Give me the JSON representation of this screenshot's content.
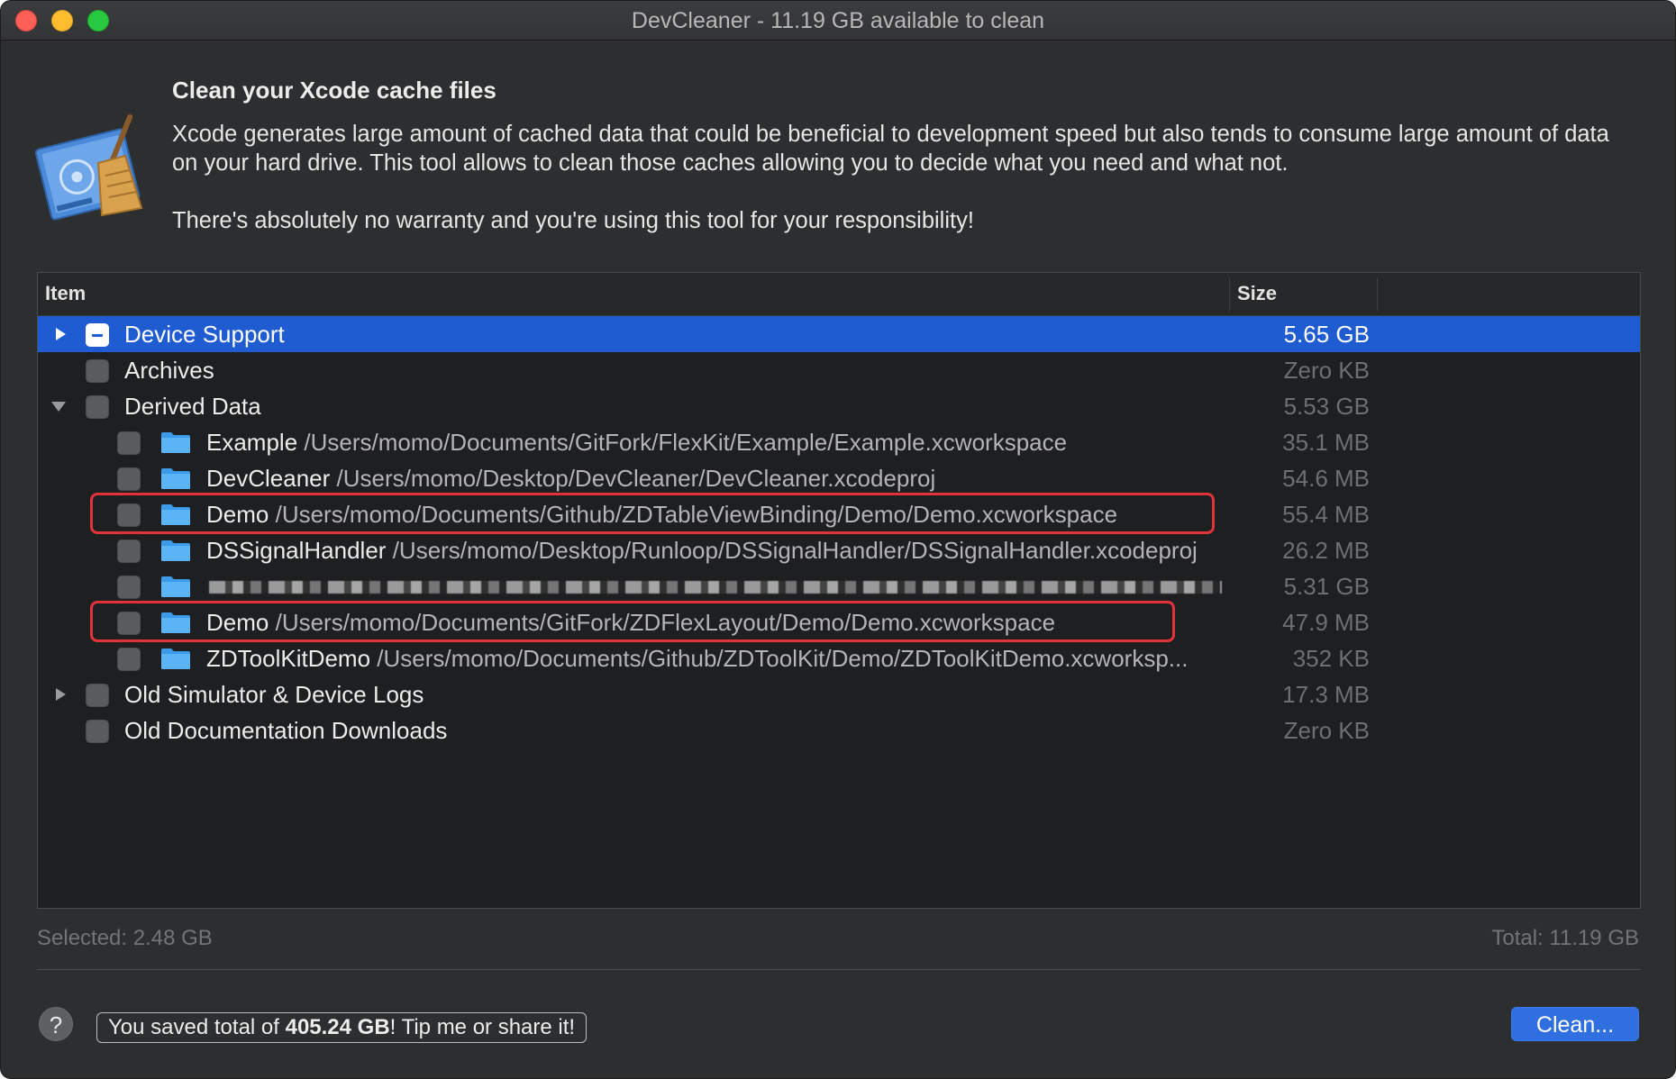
{
  "window": {
    "title": "DevCleaner - 11.19 GB available to clean"
  },
  "header": {
    "heading": "Clean your Xcode cache files",
    "description": "Xcode generates large amount of cached data that could be beneficial to development speed but also tends to consume large amount of data on your hard drive. This tool allows to clean those caches allowing you to decide what you need and what not.",
    "warning": "There's absolutely no warranty and you're using this tool for your responsibility!"
  },
  "table": {
    "columns": {
      "item": "Item",
      "size": "Size"
    },
    "rows": [
      {
        "name": "Device Support",
        "path": "",
        "size": "5.65 GB"
      },
      {
        "name": "Archives",
        "path": "",
        "size": "Zero KB"
      },
      {
        "name": "Derived Data",
        "path": "",
        "size": "5.53 GB"
      },
      {
        "name": "Example",
        "path": "/Users/momo/Documents/GitFork/FlexKit/Example/Example.xcworkspace",
        "size": "35.1 MB"
      },
      {
        "name": "DevCleaner",
        "path": "/Users/momo/Desktop/DevCleaner/DevCleaner.xcodeproj",
        "size": "54.6 MB"
      },
      {
        "name": "Demo",
        "path": "/Users/momo/Documents/Github/ZDTableViewBinding/Demo/Demo.xcworkspace",
        "size": "55.4 MB"
      },
      {
        "name": "DSSignalHandler",
        "path": "/Users/momo/Desktop/Runloop/DSSignalHandler/DSSignalHandler.xcodeproj",
        "size": "26.2 MB"
      },
      {
        "name": "",
        "path": "",
        "size": "5.31 GB"
      },
      {
        "name": "Demo",
        "path": "/Users/momo/Documents/GitFork/ZDFlexLayout/Demo/Demo.xcworkspace",
        "size": "47.9 MB"
      },
      {
        "name": "ZDToolKitDemo",
        "path": "/Users/momo/Documents/Github/ZDToolKit/Demo/ZDToolKitDemo.xcworksp...",
        "size": "352 KB"
      },
      {
        "name": "Old Simulator & Device Logs",
        "path": "",
        "size": "17.3 MB"
      },
      {
        "name": "Old Documentation Downloads",
        "path": "",
        "size": "Zero KB"
      }
    ]
  },
  "footer": {
    "selected": "Selected: 2.48 GB",
    "total": "Total: 11.19 GB",
    "help_label": "?",
    "tip_prefix": "You saved total of ",
    "tip_amount": "405.24 GB",
    "tip_suffix": "! Tip me or share it!",
    "clean_button": "Clean..."
  },
  "colors": {
    "selection": "#1f5bd1",
    "highlight": "#e0343a",
    "primary_button": "#2f6fe0"
  }
}
